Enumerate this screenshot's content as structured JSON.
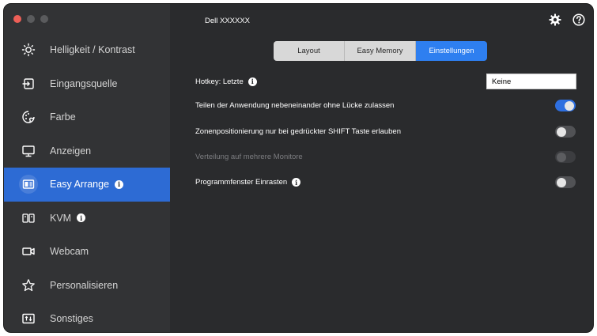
{
  "window": {
    "title": "Dell XXXXXX"
  },
  "sidebar": {
    "items": [
      {
        "label": "Helligkeit / Kontrast",
        "icon": "brightness-icon"
      },
      {
        "label": "Eingangsquelle",
        "icon": "input-source-icon"
      },
      {
        "label": "Farbe",
        "icon": "color-icon"
      },
      {
        "label": "Anzeigen",
        "icon": "display-icon"
      },
      {
        "label": "Easy Arrange",
        "icon": "easy-arrange-icon",
        "active": true
      },
      {
        "label": "KVM",
        "icon": "kvm-icon"
      },
      {
        "label": "Webcam",
        "icon": "webcam-icon"
      },
      {
        "label": "Personalisieren",
        "icon": "star-icon"
      },
      {
        "label": "Sonstiges",
        "icon": "others-icon"
      }
    ]
  },
  "tabs": [
    {
      "label": "Layout"
    },
    {
      "label": "Easy Memory"
    },
    {
      "label": "Einstellungen",
      "active": true
    }
  ],
  "settings": {
    "hotkey_label": "Hotkey: Letzte",
    "hotkey_value": "Keine",
    "share_label": "Teilen der Anwendung nebeneinander ohne Lücke zulassen",
    "share_on": true,
    "zone_label": "Zonenpositionierung nur bei gedrückter SHIFT Taste erlauben",
    "zone_on": false,
    "multi_label": "Verteilung auf mehrere Monitore",
    "multi_enabled": false,
    "snap_label": "Programmfenster Einrasten",
    "snap_on": false
  },
  "colors": {
    "accent": "#2d6bd4",
    "tab_active": "#2e7ff0",
    "background": "#2a2b2d",
    "sidebar": "#323335"
  },
  "info_glyph": "i"
}
